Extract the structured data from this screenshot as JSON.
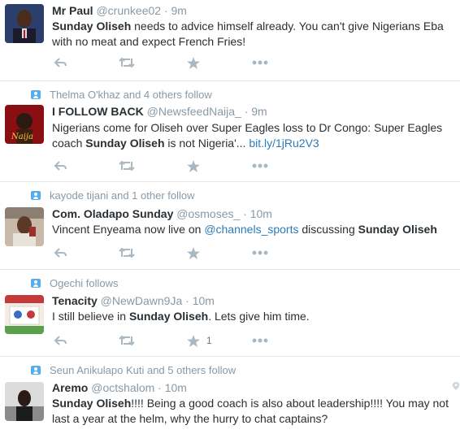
{
  "colors": {
    "accent": "#55acee",
    "link": "#2b7bb9",
    "muted": "#8899a6",
    "text": "#292f33"
  },
  "icons": [
    "reply-icon",
    "retweet-icon",
    "favorite-icon",
    "more-icon",
    "follow-context-icon",
    "location-pin-icon"
  ],
  "tweets": [
    {
      "context": "",
      "name": "Mr Paul",
      "handle": "@crunkee02",
      "sep": "·",
      "time": "9m",
      "parts": [
        {
          "text": "Sunday Oliseh",
          "style": "hl"
        },
        {
          "text": "  needs to advice himself already. You can't give Nigerians Eba with no meat and expect French Fries!",
          "style": ""
        }
      ],
      "favorites": ""
    },
    {
      "context": "Thelma O'khaz and 4 others follow",
      "name": "I FOLLOW BACK",
      "handle": "@NewsfeedNaija_",
      "sep": "·",
      "time": "9m",
      "parts": [
        {
          "text": "Nigerians come for Oliseh over Super Eagles loss to Dr Congo: Super Eagles coach ",
          "style": ""
        },
        {
          "text": "Sunday Oliseh",
          "style": "hl"
        },
        {
          "text": " is not Nigeria'... ",
          "style": ""
        },
        {
          "text": "bit.ly/1jRu2V3",
          "style": "link"
        }
      ],
      "favorites": ""
    },
    {
      "context": "kayode tijani and 1 other follow",
      "name": "Com. Oladapo Sunday",
      "handle": "@osmoses_",
      "sep": "·",
      "time": "10m",
      "parts": [
        {
          "text": "Vincent Enyeama now live on ",
          "style": ""
        },
        {
          "text": "@channels_sports",
          "style": "link"
        },
        {
          "text": " discussing ",
          "style": ""
        },
        {
          "text": "Sunday Oliseh",
          "style": "hl"
        }
      ],
      "favorites": ""
    },
    {
      "context": "Ogechi follows",
      "name": "Tenacity",
      "handle": "@NewDawn9Ja",
      "sep": "·",
      "time": "10m",
      "parts": [
        {
          "text": "I still believe in ",
          "style": ""
        },
        {
          "text": "Sunday Oliseh",
          "style": "hl"
        },
        {
          "text": ". Lets give him time.",
          "style": ""
        }
      ],
      "favorites": "1"
    },
    {
      "context": "Seun Anikulapo Kuti and 5 others follow",
      "name": "Aremo",
      "handle": "@octshalom",
      "sep": "·",
      "time": "10m",
      "parts": [
        {
          "text": "Sunday Oliseh",
          "style": "hl"
        },
        {
          "text": "!!!!  Being a good coach is also about leadership!!!!  You may not last a year at the helm,  why the hurry to chat captains?",
          "style": ""
        }
      ],
      "favorites": ""
    }
  ]
}
